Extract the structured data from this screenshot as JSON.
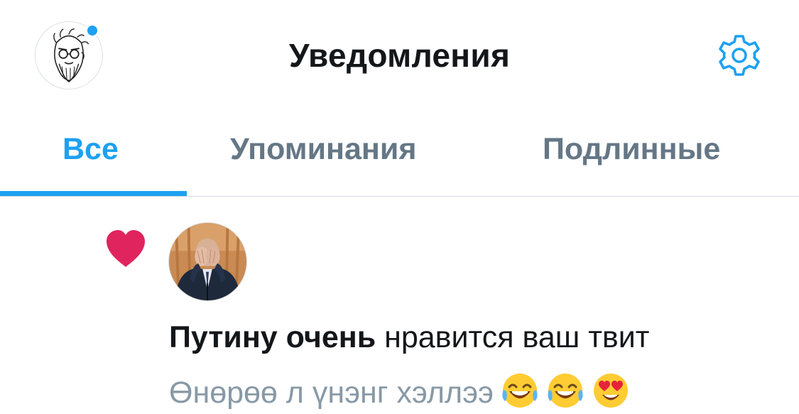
{
  "header": {
    "title": "Уведомления",
    "avatar_icon": "profile-avatar",
    "settings_icon": "gear-icon",
    "unread_dot_color": "#1da1f2"
  },
  "tabs": [
    {
      "label": "Все",
      "active": true
    },
    {
      "label": "Упоминания",
      "active": false
    },
    {
      "label": "Подлинные",
      "active": false
    }
  ],
  "notification": {
    "type_icon": "heart-icon",
    "heart_color": "#e0245e",
    "actor_bold": "Путину очень",
    "action_text": " нравится ваш твит",
    "quoted_text": "Өнөрөө л үнэнг хэллээ",
    "emojis": [
      "face-with-tears-of-joy",
      "face-with-tears-of-joy",
      "smiling-face-with-heart-eyes"
    ]
  },
  "colors": {
    "accent": "#1da1f2",
    "text_primary": "#14171a",
    "text_secondary": "#657786",
    "text_muted": "#8899a6"
  }
}
